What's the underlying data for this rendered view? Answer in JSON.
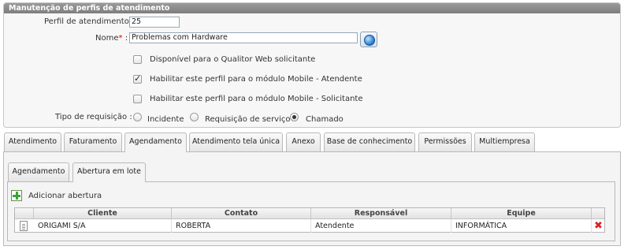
{
  "form": {
    "title": "Manutenção de perfis de atendimento",
    "perfil_label": "Perfil de atendimento :",
    "perfil_value": "25",
    "nome_label": "Nome",
    "nome_required": "*",
    "nome_colon": ":",
    "nome_value": "Problemas com Hardware",
    "checkboxes": [
      {
        "label": "Disponível para o Qualitor Web solicitante",
        "checked": false
      },
      {
        "label": "Habilitar este perfil para o módulo Mobile - Atendente",
        "checked": true
      },
      {
        "label": "Habilitar este perfil para o módulo Mobile - Solicitante",
        "checked": false
      }
    ],
    "tipo_label": "Tipo de requisição :",
    "tipo_options": [
      {
        "label": "Incidente",
        "selected": false
      },
      {
        "label": "Requisição de serviço",
        "selected": false
      },
      {
        "label": "Chamado",
        "selected": true
      }
    ]
  },
  "tabs": [
    {
      "label": "Atendimento",
      "active": false
    },
    {
      "label": "Faturamento",
      "active": false
    },
    {
      "label": "Agendamento",
      "active": true
    },
    {
      "label": "Atendimento tela única",
      "active": false
    },
    {
      "label": "Anexo",
      "active": false
    },
    {
      "label": "Base de conhecimento",
      "active": false
    },
    {
      "label": "Permissões",
      "active": false
    },
    {
      "label": "Multiempresa",
      "active": false
    }
  ],
  "subtabs": [
    {
      "label": "Agendamento",
      "active": false
    },
    {
      "label": "Abertura em lote",
      "active": true
    }
  ],
  "add_label": "Adicionar abertura",
  "grid": {
    "columns": [
      "Cliente",
      "Contato",
      "Responsável",
      "Equipe"
    ],
    "rows": [
      {
        "cliente": "ORIGAMI S/A",
        "contato": "ROBERTA",
        "responsavel": "Atendente",
        "equipe": "INFORMÁTICA"
      }
    ]
  },
  "icons": {
    "search": "globe-icon",
    "add": "plus-icon",
    "row": "document-icon",
    "delete": "delete-icon"
  },
  "colors": {
    "title_bar": "#8a8a8a",
    "required": "#dd0000",
    "add": "#3aa336",
    "delete": "#e02020"
  }
}
